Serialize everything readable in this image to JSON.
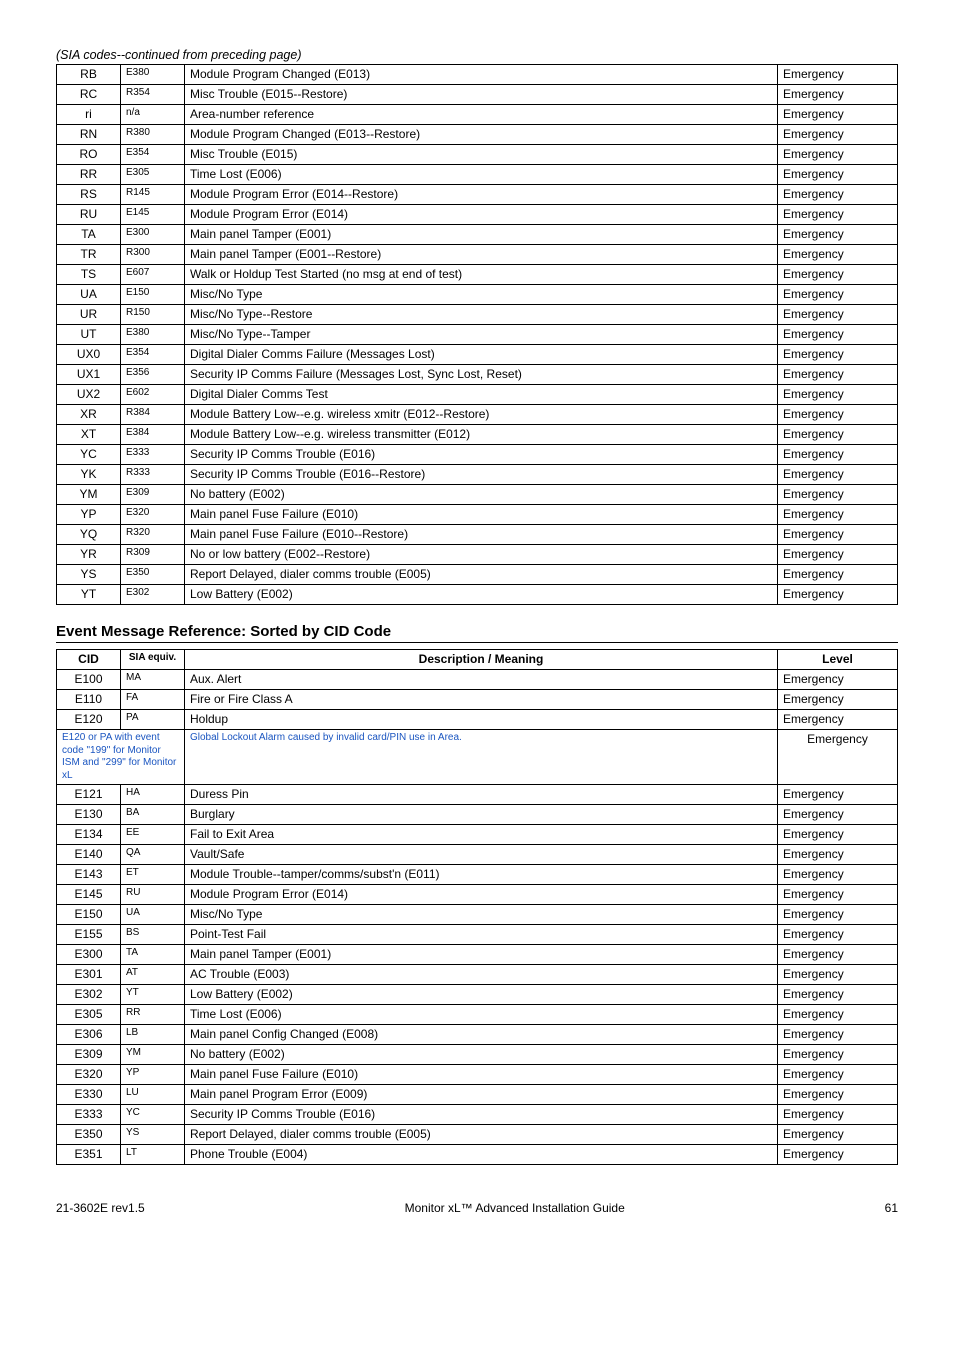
{
  "caption1": "(SIA codes--continued from preceding page)",
  "sia_rows": [
    {
      "a": "RB",
      "b": "E380",
      "c": "Module Program Changed (E013)",
      "d": "Emergency"
    },
    {
      "a": "RC",
      "b": "R354",
      "c": "Misc Trouble (E015--Restore)",
      "d": "Emergency"
    },
    {
      "a": "ri",
      "b": "n/a",
      "c": "Area-number reference",
      "d": "Emergency"
    },
    {
      "a": "RN",
      "b": "R380",
      "c": "Module Program Changed (E013--Restore)",
      "d": "Emergency"
    },
    {
      "a": "RO",
      "b": "E354",
      "c": "Misc Trouble (E015)",
      "d": "Emergency"
    },
    {
      "a": "RR",
      "b": "E305",
      "c": "Time Lost (E006)",
      "d": "Emergency"
    },
    {
      "a": "RS",
      "b": "R145",
      "c": "Module Program Error (E014--Restore)",
      "d": "Emergency"
    },
    {
      "a": "RU",
      "b": "E145",
      "c": "Module Program Error (E014)",
      "d": "Emergency"
    },
    {
      "a": "TA",
      "b": "E300",
      "c": "Main panel Tamper (E001)",
      "d": "Emergency"
    },
    {
      "a": "TR",
      "b": "R300",
      "c": "Main panel Tamper (E001--Restore)",
      "d": "Emergency"
    },
    {
      "a": "TS",
      "b": "E607",
      "c": "Walk or Holdup Test Started (no msg at end of test)",
      "d": "Emergency"
    },
    {
      "a": "UA",
      "b": "E150",
      "c": "Misc/No Type",
      "d": "Emergency"
    },
    {
      "a": "UR",
      "b": "R150",
      "c": "Misc/No Type--Restore",
      "d": "Emergency"
    },
    {
      "a": "UT",
      "b": "E380",
      "c": "Misc/No Type--Tamper",
      "d": "Emergency"
    },
    {
      "a": "UX0",
      "b": "E354",
      "c": "Digital Dialer Comms Failure (Messages Lost)",
      "d": "Emergency"
    },
    {
      "a": "UX1",
      "b": "E356",
      "c": "Security IP Comms Failure (Messages Lost, Sync Lost, Reset)",
      "d": "Emergency"
    },
    {
      "a": "UX2",
      "b": "E602",
      "c": "Digital Dialer Comms Test",
      "d": "Emergency"
    },
    {
      "a": "XR",
      "b": "R384",
      "c": "Module Battery Low--e.g. wireless xmitr (E012--Restore)",
      "d": "Emergency"
    },
    {
      "a": "XT",
      "b": "E384",
      "c": "Module Battery Low--e.g. wireless transmitter (E012)",
      "d": "Emergency"
    },
    {
      "a": "YC",
      "b": "E333",
      "c": "Security IP Comms Trouble (E016)",
      "d": "Emergency"
    },
    {
      "a": "YK",
      "b": "R333",
      "c": "Security IP Comms Trouble (E016--Restore)",
      "d": "Emergency"
    },
    {
      "a": "YM",
      "b": "E309",
      "c": "No battery (E002)",
      "d": "Emergency"
    },
    {
      "a": "YP",
      "b": "E320",
      "c": "Main panel Fuse Failure (E010)",
      "d": "Emergency"
    },
    {
      "a": "YQ",
      "b": "R320",
      "c": "Main panel Fuse Failure (E010--Restore)",
      "d": "Emergency"
    },
    {
      "a": "YR",
      "b": "R309",
      "c": "No or low battery (E002--Restore)",
      "d": "Emergency"
    },
    {
      "a": "YS",
      "b": "E350",
      "c": "Report Delayed, dialer comms trouble (E005)",
      "d": "Emergency"
    },
    {
      "a": "YT",
      "b": "E302",
      "c": "Low Battery (E002)",
      "d": "Emergency"
    }
  ],
  "section_title": "Event Message Reference:  Sorted by CID Code",
  "cid_headers": {
    "a": "CID",
    "b": "SIA equiv.",
    "c": "Description / Meaning",
    "d": "Level"
  },
  "cid_note": {
    "left": "E120 or PA with event code \"199\" for Monitor ISM and \"299\" for Monitor xL",
    "mid": "Global Lockout Alarm caused by invalid card/PIN use in Area.",
    "right": "Emergency"
  },
  "cid_rows_pre": [
    {
      "a": "E100",
      "b": "MA",
      "c": "Aux. Alert",
      "d": "Emergency"
    },
    {
      "a": "E110",
      "b": "FA",
      "c": "Fire or Fire Class A",
      "d": "Emergency"
    },
    {
      "a": "E120",
      "b": "PA",
      "c": "Holdup",
      "d": "Emergency"
    }
  ],
  "cid_rows_post": [
    {
      "a": "E121",
      "b": "HA",
      "c": "Duress Pin",
      "d": "Emergency"
    },
    {
      "a": "E130",
      "b": "BA",
      "c": "Burglary",
      "d": "Emergency"
    },
    {
      "a": "E134",
      "b": "EE",
      "c": "Fail to Exit Area",
      "d": "Emergency"
    },
    {
      "a": "E140",
      "b": "QA",
      "c": "Vault/Safe",
      "d": "Emergency"
    },
    {
      "a": "E143",
      "b": "ET",
      "c": "Module Trouble--tamper/comms/subst'n (E011)",
      "d": "Emergency"
    },
    {
      "a": "E145",
      "b": "RU",
      "c": "Module Program Error (E014)",
      "d": "Emergency"
    },
    {
      "a": "E150",
      "b": "UA",
      "c": "Misc/No Type",
      "d": "Emergency"
    },
    {
      "a": "E155",
      "b": "BS",
      "c": "Point-Test Fail",
      "d": "Emergency"
    },
    {
      "a": "E300",
      "b": "TA",
      "c": "Main panel Tamper (E001)",
      "d": "Emergency"
    },
    {
      "a": "E301",
      "b": "AT",
      "c": "AC Trouble (E003)",
      "d": "Emergency"
    },
    {
      "a": "E302",
      "b": "YT",
      "c": "Low Battery (E002)",
      "d": "Emergency"
    },
    {
      "a": "E305",
      "b": "RR",
      "c": "Time Lost (E006)",
      "d": "Emergency"
    },
    {
      "a": "E306",
      "b": "LB",
      "c": "Main panel Config Changed (E008)",
      "d": "Emergency"
    },
    {
      "a": "E309",
      "b": "YM",
      "c": "No battery (E002)",
      "d": "Emergency"
    },
    {
      "a": "E320",
      "b": "YP",
      "c": "Main panel Fuse Failure (E010)",
      "d": "Emergency"
    },
    {
      "a": "E330",
      "b": "LU",
      "c": "Main panel Program Error (E009)",
      "d": "Emergency"
    },
    {
      "a": "E333",
      "b": "YC",
      "c": "Security IP Comms Trouble (E016)",
      "d": "Emergency"
    },
    {
      "a": "E350",
      "b": "YS",
      "c": "Report Delayed, dialer comms trouble (E005)",
      "d": "Emergency"
    },
    {
      "a": "E351",
      "b": "LT",
      "c": "Phone Trouble (E004)",
      "d": "Emergency"
    }
  ],
  "footer": {
    "left": "21-3602E rev1.5",
    "center": "Monitor xL™ Advanced Installation Guide",
    "right": "61"
  }
}
